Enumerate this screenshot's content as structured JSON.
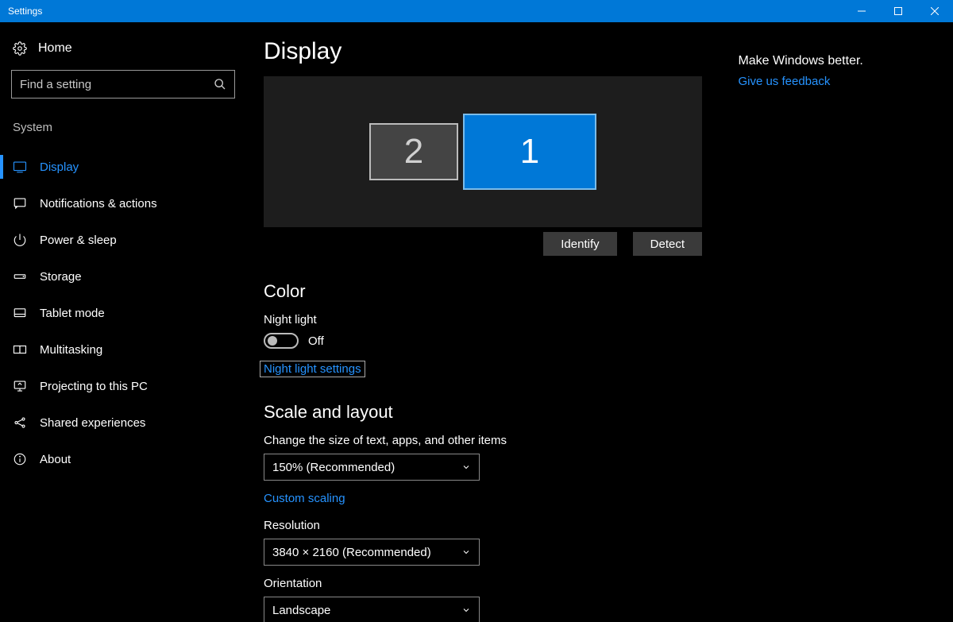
{
  "window": {
    "title": "Settings"
  },
  "home_label": "Home",
  "search": {
    "placeholder": "Find a setting"
  },
  "sidebar": {
    "category": "System",
    "items": [
      {
        "label": "Display",
        "active": true
      },
      {
        "label": "Notifications & actions"
      },
      {
        "label": "Power & sleep"
      },
      {
        "label": "Storage"
      },
      {
        "label": "Tablet mode"
      },
      {
        "label": "Multitasking"
      },
      {
        "label": "Projecting to this PC"
      },
      {
        "label": "Shared experiences"
      },
      {
        "label": "About"
      }
    ]
  },
  "main": {
    "title": "Display",
    "monitors": {
      "secondary": "2",
      "primary": "1"
    },
    "identify_btn": "Identify",
    "detect_btn": "Detect",
    "color": {
      "heading": "Color",
      "night_light_label": "Night light",
      "night_light_state": "Off",
      "night_light_settings": "Night light settings"
    },
    "scale": {
      "heading": "Scale and layout",
      "change_size_label": "Change the size of text, apps, and other items",
      "scale_value": "150% (Recommended)",
      "custom_scaling": "Custom scaling",
      "resolution_label": "Resolution",
      "resolution_value": "3840 × 2160 (Recommended)",
      "orientation_label": "Orientation",
      "orientation_value": "Landscape"
    }
  },
  "aside": {
    "title": "Make Windows better.",
    "feedback_link": "Give us feedback"
  }
}
